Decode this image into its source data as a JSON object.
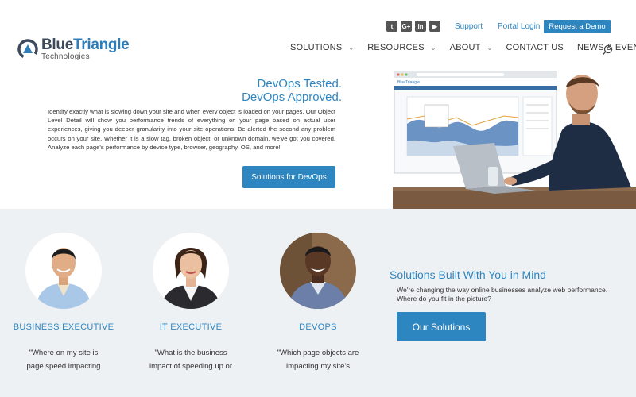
{
  "brand": {
    "name_part1": "Blue",
    "name_part2": "Triangle",
    "tagline": "Technologies"
  },
  "social": {
    "icons": [
      "twitter-icon",
      "google-plus-icon",
      "linkedin-icon",
      "youtube-icon"
    ],
    "glyphs": [
      "t",
      "G+",
      "in",
      "▶"
    ]
  },
  "top_links": {
    "support": "Support",
    "portal": "Portal Login",
    "demo": "Request a Demo"
  },
  "nav": {
    "items": [
      {
        "label": "SOLUTIONS",
        "chevron": "⌄"
      },
      {
        "label": "RESOURCES",
        "chevron": "⌄"
      },
      {
        "label": "ABOUT",
        "chevron": "⌄"
      },
      {
        "label": "CONTACT US"
      },
      {
        "label": "NEWS & EVENTS"
      }
    ]
  },
  "hero": {
    "title_line1": "DevOps Tested.",
    "title_line2": "DevOps Approved.",
    "body": "Identify exactly what is slowing down your site and when every object is loaded on your pages. Our Object Level Detail will show you performance trends of everything on your page based on actual user experiences, giving you deeper granularity into your site operations. Be alerted the second any problem occurs on your site. Whether it is a slow tag, broken object, or unknown domain, we've got you covered. Analyze each page's performance by device type, browser, geography, OS, and more!",
    "button": "Solutions for DevOps"
  },
  "personas": [
    {
      "title": "BUSINESS EXECUTIVE",
      "quote_line1": "\"Where on my site is",
      "quote_line2": "page speed impacting"
    },
    {
      "title": "IT EXECUTIVE",
      "quote_line1": "\"What is the business",
      "quote_line2": "impact of speeding up or"
    },
    {
      "title": "DEVOPS",
      "quote_line1": "\"Which page objects are",
      "quote_line2": "impacting my site's"
    }
  ],
  "solutions": {
    "title": "Solutions Built With You in Mind",
    "body": "We're changing the way online businesses analyze web performance. Where do you fit in the picture?",
    "button": "Our Solutions"
  },
  "colors": {
    "accent": "#2e86c1",
    "band": "#eef1f3"
  }
}
